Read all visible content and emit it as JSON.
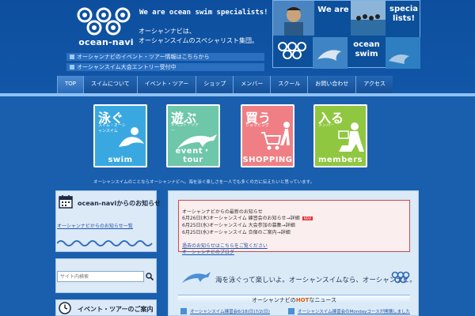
{
  "header": {
    "logo_text": "ocean-navi",
    "tagline": "We are ocean swim specialists!",
    "desc_line1": "オーシャンナビは、",
    "desc_line2": "オーシャンスイムのスペシャリスト集団。",
    "news_line1": "オーシャンナビのイベント・ツアー情報はこちらから",
    "news_line2": "オーシャンスイム大会エントリー受付中"
  },
  "banner": {
    "we_are": "We are",
    "specialists": "specia lists!",
    "ocean_swim": "ocean swim"
  },
  "nav": {
    "items": [
      "TOP",
      "スイムについて",
      "イベント・ツアー",
      "ショップ",
      "メンバー",
      "スクール",
      "お問い合わせ",
      "アクセス"
    ]
  },
  "tiles": [
    {
      "big": "泳ぐ",
      "small": "スイム・オーシャンスイム",
      "foot": "swim",
      "color": "#3aa8e0"
    },
    {
      "big": "遊ぶ",
      "small": "イベント・ツアー",
      "foot": "event・tour",
      "color": "#6dc7a8"
    },
    {
      "big": "買う",
      "small": "ショッピング",
      "foot": "SHOPPING",
      "color": "#ef7f84"
    },
    {
      "big": "入る",
      "small": "メンバー",
      "foot": "members",
      "color": "#8fc740"
    }
  ],
  "slogan": "オーシャンスイムのことならオーシャンナビへ。海を泳ぐ楽しさを一人でも多くの方に伝えたいと思っています。",
  "sidebar": {
    "title1": "ocean-naviからのお知らせ",
    "link1": "オーシャンナビからのお知らせ一覧",
    "search_placeholder": "サイト内検索",
    "title2": "イベント・ツアーのご案内"
  },
  "notice": {
    "title": "オーシャンナビからの最新のお知らせ",
    "rows": [
      "6月26日(木)オーシャンスイム 練習会のお知らせ→詳細",
      "6月25日(水)オーシャンスイム 大会参加の募集→詳細",
      "6月25日(水)オーシャンスイム 合宿のご案内→詳細"
    ],
    "new_label": "NEW",
    "link1": "過去のお知らせはこちらをご覧ください",
    "link2": "オーシャンナビのブログ"
  },
  "main": {
    "slogan": "海を泳ぐって楽しいよ。オーシャンスイムなら、オーシャンナビ。",
    "hot_prefix": "オーシャンナビの",
    "hot_word": "HOT",
    "hot_suffix": "なニュース",
    "hot_left": "オーシャンスイム練習会6/18(日)7/2(日)",
    "hot_right": "オーシャンスイム練習会のMondayコースが開講しました"
  }
}
